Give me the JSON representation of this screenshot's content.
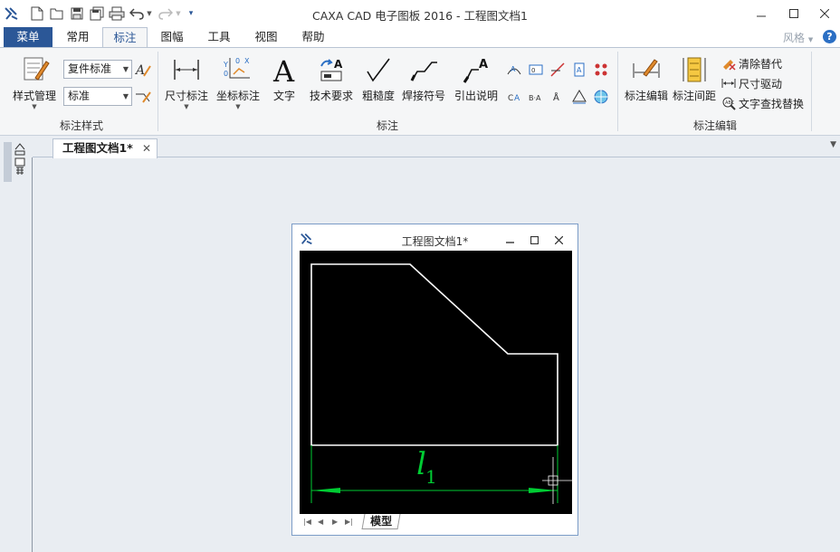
{
  "title_bar": {
    "title": "CAXA CAD 电子图板 2016 - 工程图文档1",
    "quick_access": [
      "new-icon",
      "open-icon",
      "save-icon",
      "save-all-icon",
      "print-icon",
      "undo-icon",
      "redo-icon",
      "customize-icon"
    ]
  },
  "menu_button": "菜单",
  "ribbon_tabs": [
    {
      "label": "常用"
    },
    {
      "label": "标注",
      "active": true
    },
    {
      "label": "图幅"
    },
    {
      "label": "工具"
    },
    {
      "label": "视图"
    },
    {
      "label": "帮助"
    }
  ],
  "style_menu": "风格",
  "groups": {
    "style": {
      "label": "标注样式",
      "manage_label": "样式管理",
      "combo1": "复件标准",
      "combo2": "标准"
    },
    "annotate": {
      "label": "标注",
      "buttons": [
        "尺寸标注",
        "坐标标注",
        "文字",
        "技术要求",
        "粗糙度",
        "焊接符号",
        "引出说明"
      ]
    },
    "edit": {
      "label": "标注编辑",
      "buttons": [
        "标注编辑",
        "标注间距"
      ],
      "small_buttons": [
        "清除替代",
        "尺寸驱动",
        "文字查找替换"
      ]
    }
  },
  "doc_tab": {
    "label": "工程图文档1*"
  },
  "child_window": {
    "title": "工程图文档1*",
    "model_tab": "模型"
  },
  "drawing": {
    "dimension_text": "l",
    "dimension_subscript": "1",
    "colors": {
      "outline": "#ffffff",
      "dimension": "#00cc33",
      "canvas": "#000000"
    }
  },
  "colors": {
    "accent": "#2b5797",
    "ribbon_bg": "#f5f6f7",
    "workspace_bg": "#e9edf2"
  }
}
